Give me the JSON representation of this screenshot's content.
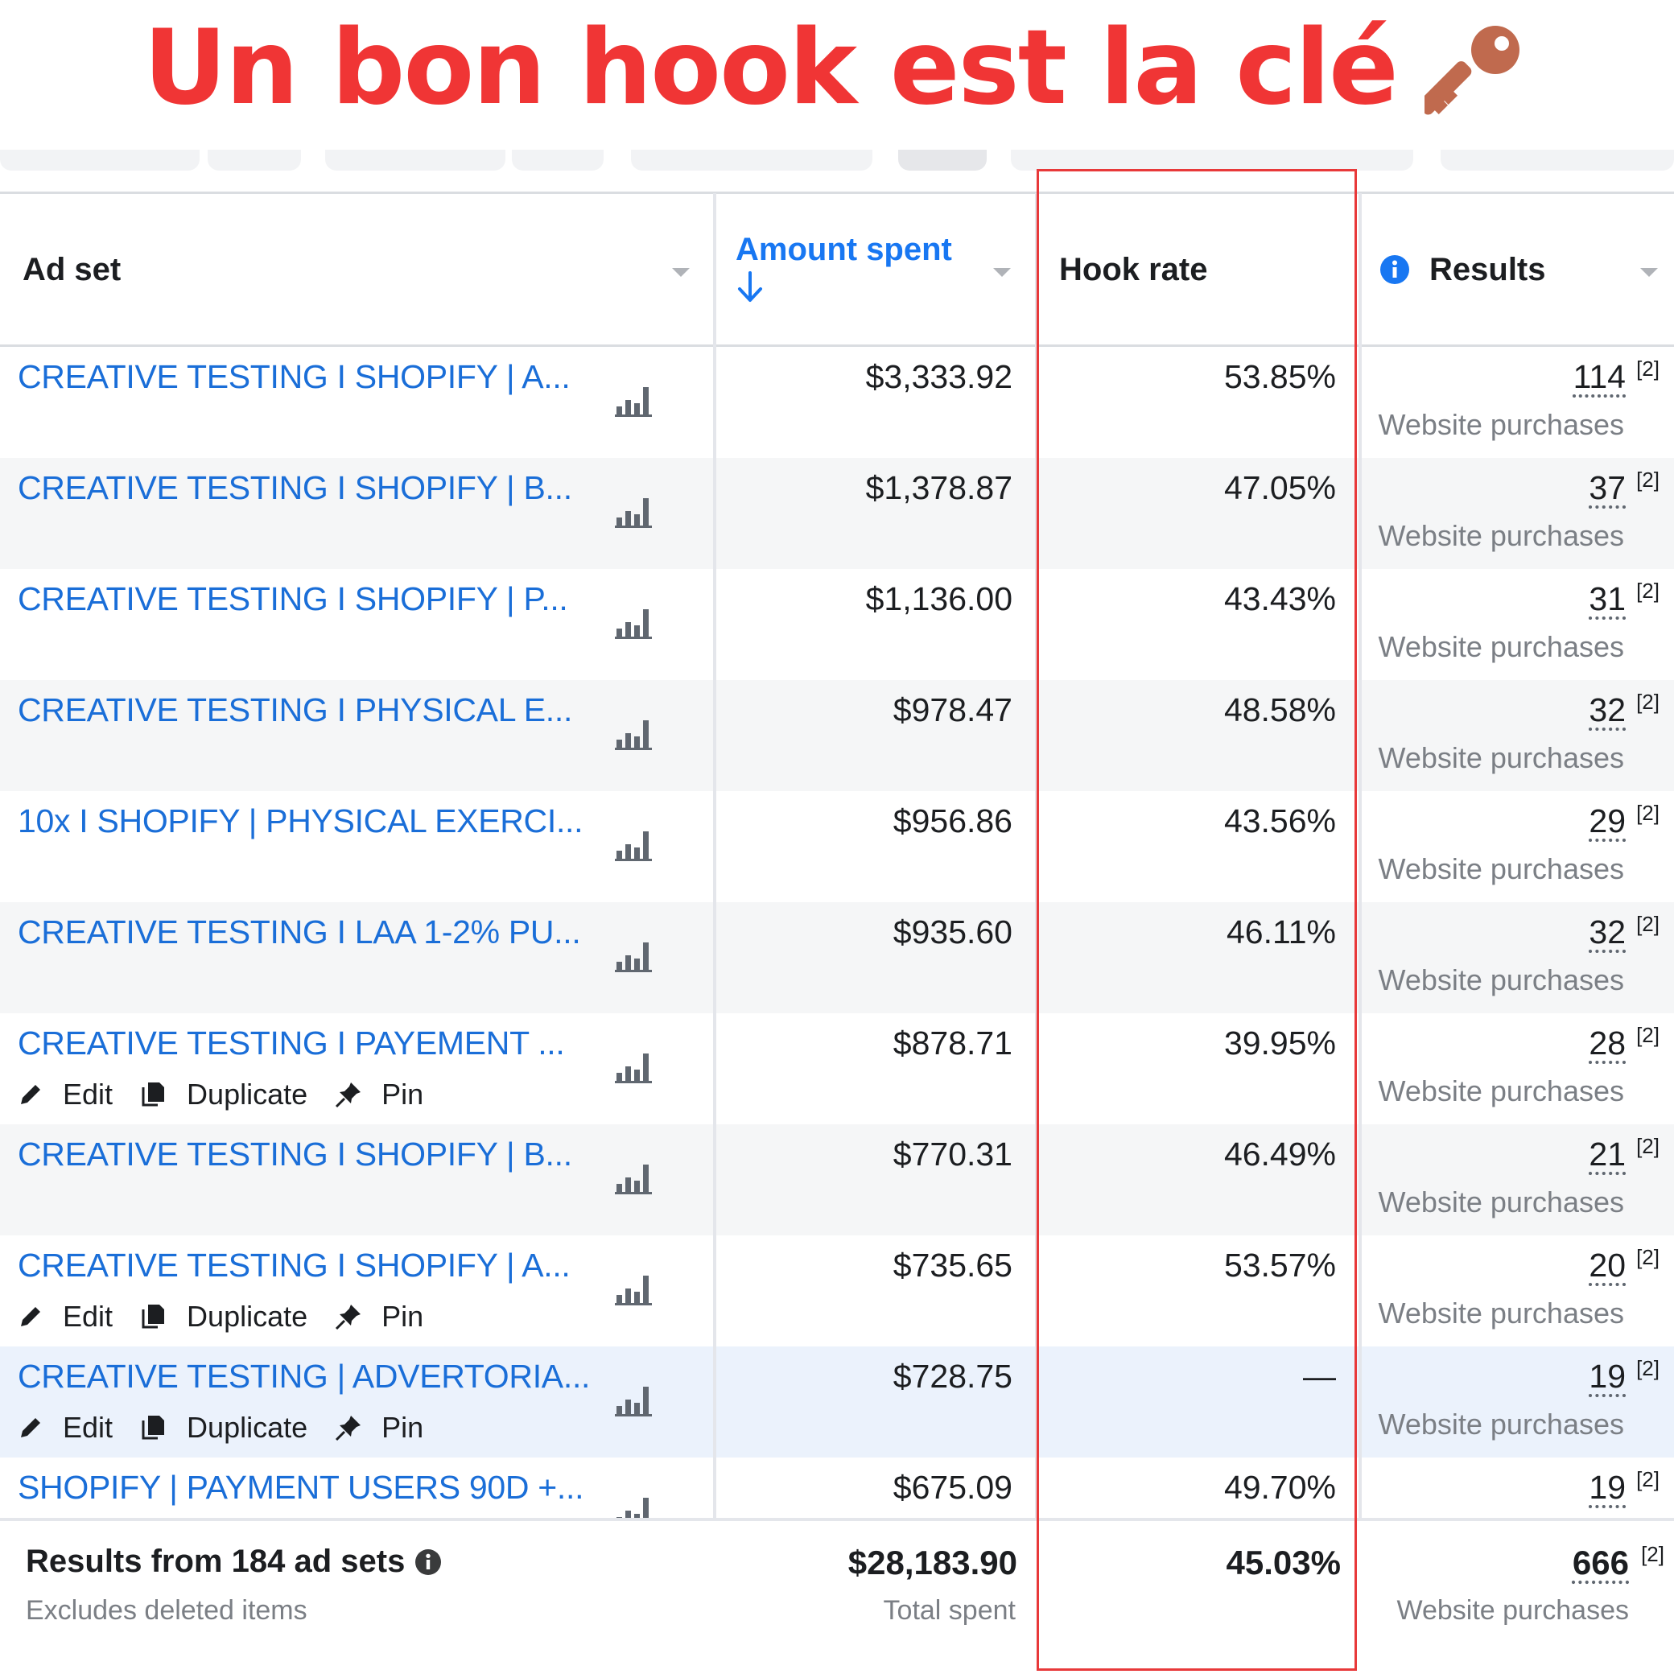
{
  "headline": "Un bon hook est la clé",
  "table": {
    "columns": {
      "ad_set": "Ad set",
      "amount_spent": "Amount spent",
      "hook_rate": "Hook rate",
      "results": "Results"
    },
    "row_actions": {
      "edit": "Edit",
      "duplicate": "Duplicate",
      "pin": "Pin"
    },
    "rows": [
      {
        "name": "CREATIVE TESTING I SHOPIFY | A...",
        "amount": "$3,333.92",
        "hook": "53.85%",
        "results": "114",
        "note": "[2]",
        "results_label": "Website purchases"
      },
      {
        "name": "CREATIVE TESTING I SHOPIFY | B...",
        "amount": "$1,378.87",
        "hook": "47.05%",
        "results": "37",
        "note": "[2]",
        "results_label": "Website purchases"
      },
      {
        "name": "CREATIVE TESTING I SHOPIFY | P...",
        "amount": "$1,136.00",
        "hook": "43.43%",
        "results": "31",
        "note": "[2]",
        "results_label": "Website purchases"
      },
      {
        "name": "CREATIVE TESTING I PHYSICAL E...",
        "amount": "$978.47",
        "hook": "48.58%",
        "results": "32",
        "note": "[2]",
        "results_label": "Website purchases"
      },
      {
        "name": "10x I SHOPIFY | PHYSICAL EXERCI...",
        "amount": "$956.86",
        "hook": "43.56%",
        "results": "29",
        "note": "[2]",
        "results_label": "Website purchases"
      },
      {
        "name": "CREATIVE TESTING I LAA 1-2% PU...",
        "amount": "$935.60",
        "hook": "46.11%",
        "results": "32",
        "note": "[2]",
        "results_label": "Website purchases"
      },
      {
        "name": "CREATIVE TESTING I PAYEMENT ...",
        "amount": "$878.71",
        "hook": "39.95%",
        "results": "28",
        "note": "[2]",
        "results_label": "Website purchases"
      },
      {
        "name": "CREATIVE TESTING I SHOPIFY | B...",
        "amount": "$770.31",
        "hook": "46.49%",
        "results": "21",
        "note": "[2]",
        "results_label": "Website purchases"
      },
      {
        "name": "CREATIVE TESTING I SHOPIFY | A...",
        "amount": "$735.65",
        "hook": "53.57%",
        "results": "20",
        "note": "[2]",
        "results_label": "Website purchases"
      },
      {
        "name": "CREATIVE TESTING | ADVERTORIA...",
        "amount": "$728.75",
        "hook": "—",
        "results": "19",
        "note": "[2]",
        "results_label": "Website purchases"
      },
      {
        "name": "SHOPIFY | PAYMENT USERS 90D +...",
        "amount": "$675.09",
        "hook": "49.70%",
        "results": "19",
        "note": "[2]",
        "results_label": ""
      }
    ],
    "footer": {
      "title": "Results from 184 ad sets",
      "subtitle": "Excludes deleted items",
      "amount": "$28,183.90",
      "amount_label": "Total spent",
      "hook": "45.03%",
      "results": "666",
      "note": "[2]",
      "results_label": "Website purchases"
    }
  },
  "colors": {
    "headline": "#f03535",
    "link": "#1a6ed8",
    "highlight": "#e8393a"
  },
  "icons": [
    "key-icon",
    "caret-down-icon",
    "arrow-down-icon",
    "info-icon",
    "chart-bars-icon",
    "pencil-icon",
    "duplicate-icon",
    "pin-icon"
  ]
}
